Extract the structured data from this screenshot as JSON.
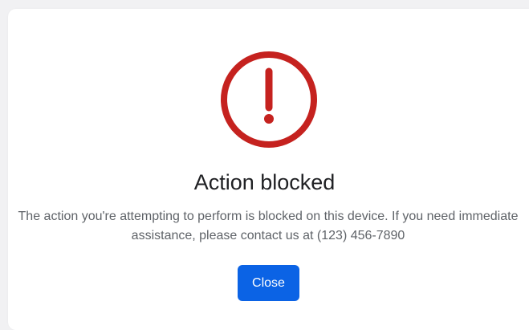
{
  "dialog": {
    "icon": "exclamation-circle-icon",
    "title": "Action blocked",
    "message": "The action you're attempting to perform is blocked on this device. If you need immediate assistance, please contact us at (123) 456-7890",
    "close_label": "Close"
  },
  "colors": {
    "alert_red": "#c5221f",
    "primary_blue": "#0b63e5",
    "title_text": "#202124",
    "body_text": "#5f6368"
  }
}
